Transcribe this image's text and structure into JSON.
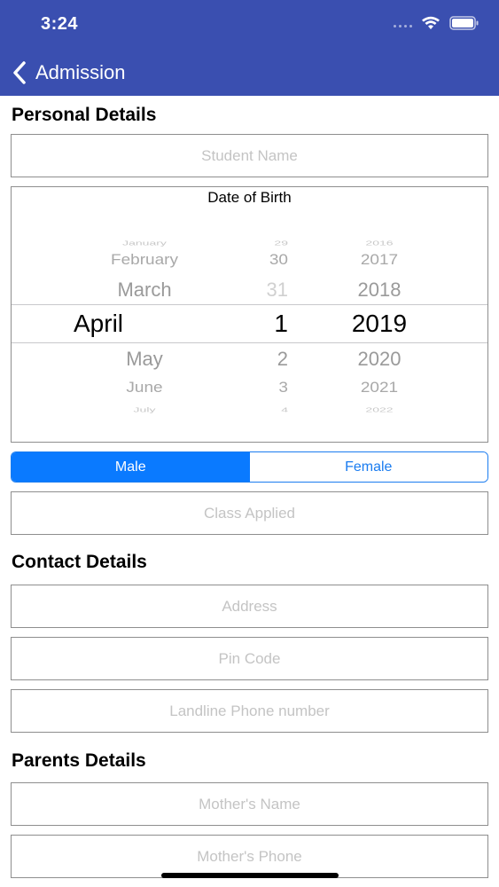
{
  "status_bar": {
    "time": "3:24"
  },
  "nav": {
    "back_label": "Admission"
  },
  "personal": {
    "title": "Personal Details",
    "student_name_placeholder": "Student Name",
    "dob_title": "Date of Birth",
    "dob_months": [
      "January",
      "February",
      "March",
      "April",
      "May",
      "June",
      "July"
    ],
    "dob_days": [
      "29",
      "30",
      "31",
      "1",
      "2",
      "3",
      "4"
    ],
    "dob_years": [
      "2016",
      "2017",
      "2018",
      "2019",
      "2020",
      "2021",
      "2022"
    ],
    "gender_options": [
      "Male",
      "Female"
    ],
    "gender_selected": "Male",
    "class_placeholder": "Class Applied"
  },
  "contact": {
    "title": "Contact Details",
    "address_placeholder": "Address",
    "pin_placeholder": "Pin Code",
    "landline_placeholder": "Landline Phone number"
  },
  "parents": {
    "title": "Parents Details",
    "mother_name_placeholder": "Mother's Name",
    "mother_phone_placeholder": "Mother's Phone"
  },
  "colors": {
    "nav_background": "#3a4fb0",
    "segment_accent": "#0a7aff",
    "field_border": "#8e8e8e",
    "placeholder": "#c4c4c4"
  }
}
